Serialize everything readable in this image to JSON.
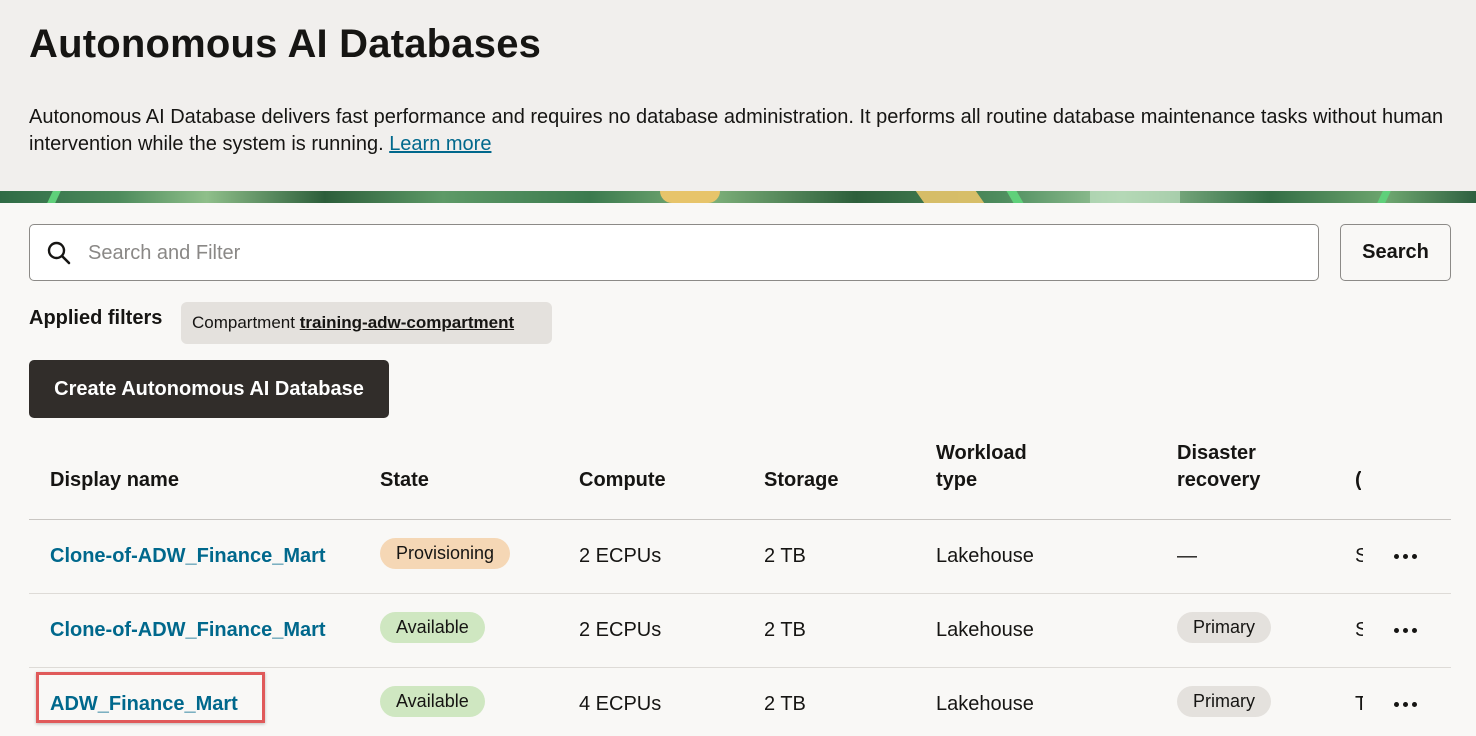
{
  "header": {
    "title": "Autonomous AI Databases",
    "description": "Autonomous AI Database delivers fast performance and requires no database administration. It performs all routine database maintenance tasks without human intervention while the system is running.",
    "learn_more": "Learn more"
  },
  "search": {
    "placeholder": "Search and Filter",
    "value": "",
    "button_label": "Search",
    "icon": "search-icon"
  },
  "filters": {
    "label": "Applied filters",
    "chips": [
      {
        "key": "Compartment",
        "value": "training-adw-compartment"
      }
    ]
  },
  "actions": {
    "create_label": "Create Autonomous AI Database"
  },
  "table": {
    "columns": {
      "display_name": "Display name",
      "state": "State",
      "compute": "Compute",
      "storage": "Storage",
      "workload_type_1": "Workload",
      "workload_type_2": "type",
      "disaster_recovery_1": "Disaster",
      "disaster_recovery_2": "recovery",
      "truncated": "("
    },
    "rows": [
      {
        "display_name": "Clone-of-ADW_Finance_Mart",
        "state": "Provisioning",
        "compute": "2 ECPUs",
        "storage": "2 TB",
        "workload_type": "Lakehouse",
        "disaster_recovery": "—",
        "truncated": "S"
      },
      {
        "display_name": "Clone-of-ADW_Finance_Mart",
        "state": "Available",
        "compute": "2 ECPUs",
        "storage": "2 TB",
        "workload_type": "Lakehouse",
        "disaster_recovery": "Primary",
        "truncated": "S"
      },
      {
        "display_name": "ADW_Finance_Mart",
        "state": "Available",
        "compute": "4 ECPUs",
        "storage": "2 TB",
        "workload_type": "Lakehouse",
        "disaster_recovery": "Primary",
        "truncated": "T"
      }
    ]
  },
  "colors": {
    "link": "#00688c",
    "provisioning_badge": "#f5d7b5",
    "available_badge": "#cfe7c1",
    "primary_badge": "#e4e1dd",
    "create_button": "#312d2a",
    "highlight": "#e05a5a"
  }
}
